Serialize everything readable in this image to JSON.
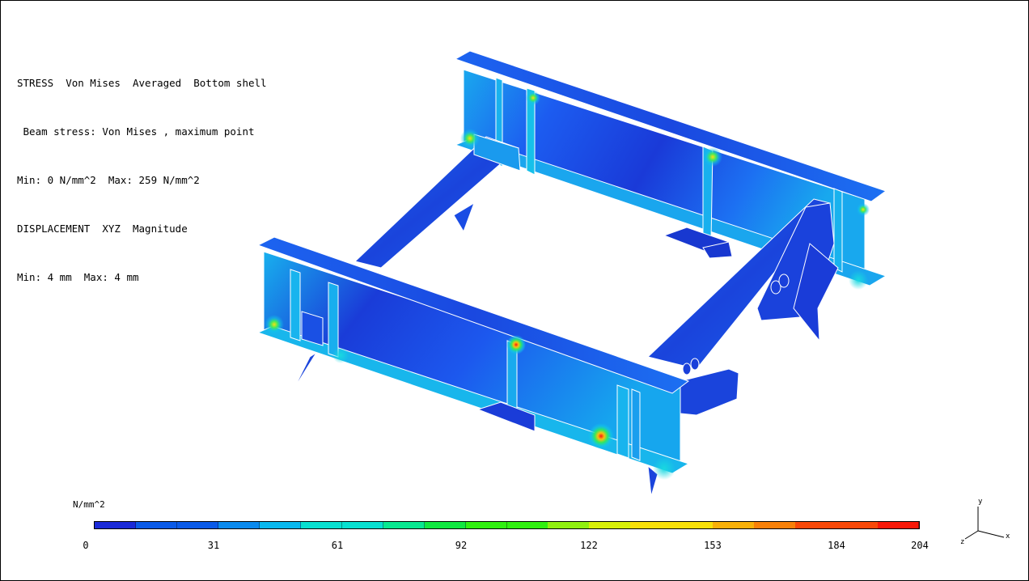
{
  "info": {
    "line1": "STRESS  Von Mises  Averaged  Bottom shell",
    "line2": " Beam stress: Von Mises , maximum point",
    "line3": "Min: 0 N/mm^2  Max: 259 N/mm^2",
    "line4": "DISPLACEMENT  XYZ  Magnitude",
    "line5": "Min: 4 mm  Max: 4 mm"
  },
  "legend": {
    "unit": "N/mm^2",
    "ticks": [
      "0",
      "31",
      "61",
      "92",
      "122",
      "153",
      "184",
      "204"
    ],
    "colors": [
      "#1a2ad8",
      "#0a5ae8",
      "#0a8aee",
      "#08b8ee",
      "#08e0d0",
      "#08e890",
      "#10e840",
      "#30f010",
      "#90f010",
      "#d8f008",
      "#f8e008",
      "#f8b008",
      "#f88008",
      "#f84808",
      "#f81808"
    ]
  },
  "axes": {
    "y": "y",
    "z": "z",
    "x": "x"
  },
  "model": {
    "description_colors": {
      "shell_dark": "#1838d8",
      "shell_mid": "#1c5cf0",
      "shell_light": "#16a2ee",
      "hot": "#f82010",
      "warm": "#f8d810",
      "green": "#28e060",
      "edge": "#ffffff"
    }
  }
}
